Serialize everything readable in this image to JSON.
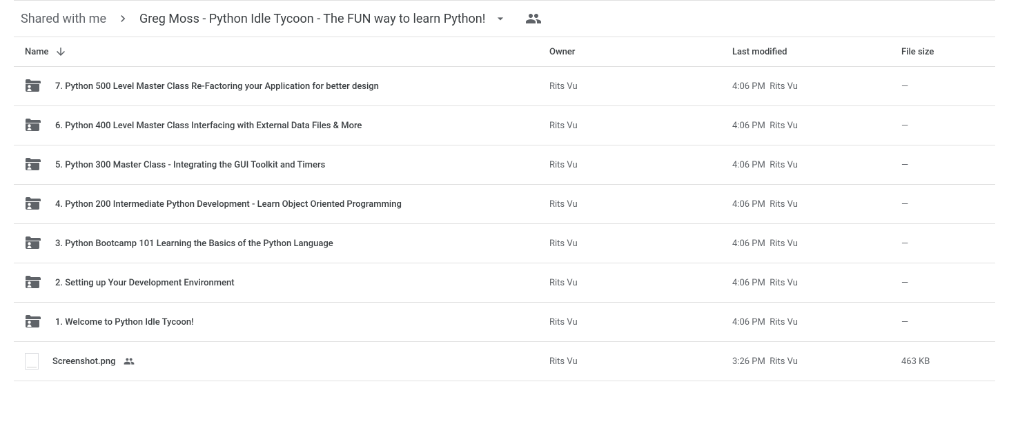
{
  "breadcrumb": {
    "root": "Shared with me",
    "current": "Greg Moss - Python Idle Tycoon - The FUN way to learn Python!"
  },
  "columns": {
    "name": "Name",
    "owner": "Owner",
    "modified": "Last modified",
    "size": "File size"
  },
  "rows": [
    {
      "type": "folder",
      "name": "7. Python 500 Level Master Class Re-Factoring your Application for better design",
      "owner": "Rits Vu",
      "modified_time": "4:06 PM",
      "modified_by": "Rits Vu",
      "size": "—",
      "shared": false
    },
    {
      "type": "folder",
      "name": "6. Python 400 Level Master Class Interfacing with External Data Files & More",
      "owner": "Rits Vu",
      "modified_time": "4:06 PM",
      "modified_by": "Rits Vu",
      "size": "—",
      "shared": false
    },
    {
      "type": "folder",
      "name": "5. Python 300 Master Class - Integrating the GUI Toolkit and Timers",
      "owner": "Rits Vu",
      "modified_time": "4:06 PM",
      "modified_by": "Rits Vu",
      "size": "—",
      "shared": false
    },
    {
      "type": "folder",
      "name": "4. Python 200 Intermediate Python Development - Learn Object Oriented Programming",
      "owner": "Rits Vu",
      "modified_time": "4:06 PM",
      "modified_by": "Rits Vu",
      "size": "—",
      "shared": false
    },
    {
      "type": "folder",
      "name": "3. Python Bootcamp 101 Learning the Basics of the Python Language",
      "owner": "Rits Vu",
      "modified_time": "4:06 PM",
      "modified_by": "Rits Vu",
      "size": "—",
      "shared": false
    },
    {
      "type": "folder",
      "name": "2. Setting up Your Development Environment",
      "owner": "Rits Vu",
      "modified_time": "4:06 PM",
      "modified_by": "Rits Vu",
      "size": "—",
      "shared": false
    },
    {
      "type": "folder",
      "name": "1. Welcome to Python Idle Tycoon!",
      "owner": "Rits Vu",
      "modified_time": "4:06 PM",
      "modified_by": "Rits Vu",
      "size": "—",
      "shared": false
    },
    {
      "type": "image",
      "name": "Screenshot.png",
      "owner": "Rits Vu",
      "modified_time": "3:26 PM",
      "modified_by": "Rits Vu",
      "size": "463 KB",
      "shared": true
    }
  ]
}
